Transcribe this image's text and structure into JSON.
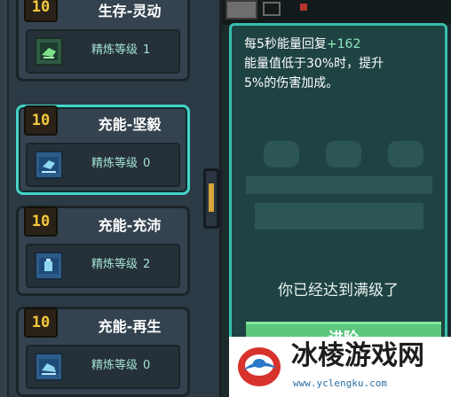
{
  "cards": [
    {
      "level": "10",
      "name": "生存-灵动",
      "refine_label": "精炼等级",
      "refine_level": "1",
      "icon": "shield-green-icon"
    },
    {
      "level": "10",
      "name": "充能-坚毅",
      "refine_label": "精炼等级",
      "refine_level": "0",
      "icon": "battery-blue-icon",
      "selected": true
    },
    {
      "level": "10",
      "name": "充能-充沛",
      "refine_label": "精炼等级",
      "refine_level": "2",
      "icon": "battery-blue-icon"
    },
    {
      "level": "10",
      "name": "充能-再生",
      "refine_label": "精炼等级",
      "refine_level": "0",
      "icon": "battery-blue-icon"
    }
  ],
  "detail": {
    "line1_prefix": "每5秒能量回复",
    "line1_value": "+162",
    "line2": "能量值低于30%时，提升",
    "line3": "5%的伤害加成。",
    "status": "你已经达到满级了",
    "upgrade_button": "进阶"
  },
  "watermark": {
    "title": "冰棱游戏网",
    "url": "www.yclengku.com"
  },
  "colors": {
    "accent": "#37bfae",
    "level_gold": "#f4c83c",
    "highlight": "#8fe6bf",
    "button_green": "#5cc77c"
  }
}
